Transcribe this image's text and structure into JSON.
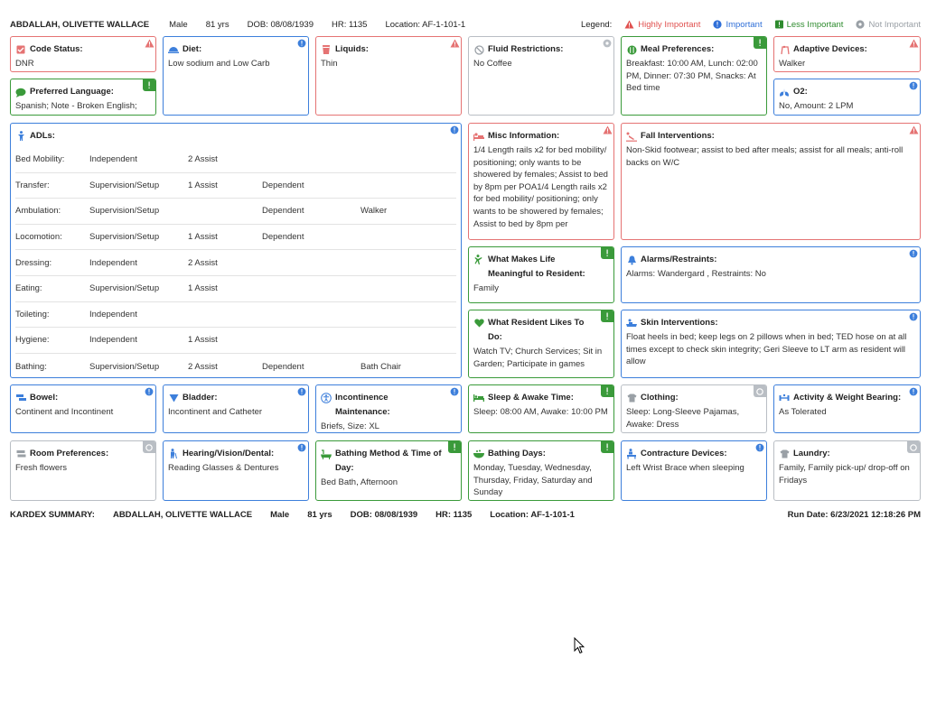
{
  "header": {
    "name": "ABDALLAH, OLIVETTE WALLACE",
    "sex": "Male",
    "age": "81 yrs",
    "dob": "DOB: 08/08/1939",
    "hr": "HR:  1135",
    "location": "Location:  AF-1-101-1"
  },
  "legend": {
    "title": "Legend:",
    "highly": "Highly Important",
    "important": "Important",
    "less": "Less Important",
    "not": "Not Important"
  },
  "colors": {
    "red": "#e57373",
    "blue": "#3d7fdb",
    "green": "#3a9a3a",
    "gray": "#b9bec4"
  },
  "cards": {
    "code_status": {
      "title": "Code Status:",
      "value": "DNR",
      "icon": "check-square-icon",
      "level": "highly-important"
    },
    "diet": {
      "title": "Diet:",
      "value": "Low sodium and Low Carb",
      "icon": "cloche-icon",
      "level": "important"
    },
    "liquids": {
      "title": "Liquids:",
      "value": "Thin",
      "icon": "cup-icon",
      "level": "highly-important"
    },
    "fluid_restrictions": {
      "title": "Fluid Restrictions:",
      "value": "No Coffee",
      "icon": "no-symbol-icon",
      "level": "not-important"
    },
    "meal_preferences": {
      "title": "Meal Preferences:",
      "value": "Breakfast: 10:00 AM, Lunch: 02:00 PM, Dinner: 07:30 PM, Snacks: At Bed time",
      "icon": "utensils-icon",
      "level": "less-important"
    },
    "adaptive_devices": {
      "title": "Adaptive Devices:",
      "value": "Walker",
      "icon": "walker-icon",
      "level": "highly-important"
    },
    "preferred_language": {
      "title": "Preferred Language:",
      "value": "Spanish; Note - Broken English;",
      "icon": "speech-bubble-icon",
      "level": "less-important"
    },
    "o2": {
      "title": "O2:",
      "value": "No, Amount: 2 LPM",
      "icon": "lungs-icon",
      "level": "important"
    },
    "adls": {
      "title": "ADLs:",
      "icon": "person-icon",
      "level": "important"
    },
    "misc": {
      "title": "Misc Information:",
      "value": "1/4 Length rails x2 for bed mobility/ positioning; only wants to be showered by females; Assist to bed by 8pm per POA1/4 Length rails x2 for bed mobility/ positioning; only wants to be showered by females; Assist to bed by 8pm per",
      "icon": "bed-person-icon",
      "level": "highly-important"
    },
    "fall": {
      "title": "Fall Interventions:",
      "value": "Non-Skid footwear; assist to bed after meals; assist for all meals; anti-roll backs on W/C",
      "icon": "falling-person-icon",
      "level": "highly-important"
    },
    "meaningful": {
      "title": "What Makes Life Meaningful to Resident:",
      "value": "Family",
      "icon": "dancing-person-icon",
      "level": "less-important"
    },
    "alarms": {
      "title": "Alarms/Restraints:",
      "value": "Alarms: Wandergard , Restraints: No",
      "icon": "bell-icon",
      "level": "important"
    },
    "likes": {
      "title": "What Resident Likes To Do:",
      "value": "Watch TV; Church Services; Sit in Garden; Participate in games",
      "icon": "heart-icon",
      "level": "less-important"
    },
    "skin": {
      "title": "Skin Interventions:",
      "value": "Float heels in bed; keep legs on 2 pillows when in bed; TED hose on at all times except to check skin integrity; Geri Sleeve to LT arm as resident will allow",
      "icon": "bath-person-icon",
      "level": "important"
    },
    "bowel": {
      "title": "Bowel:",
      "value": "Continent and Incontinent",
      "icon": "pipe-icon",
      "level": "important"
    },
    "bladder": {
      "title": "Bladder:",
      "value": "Incontinent and Catheter",
      "icon": "drop-icon",
      "level": "important"
    },
    "incontinence": {
      "title": "Incontinence Maintenance:",
      "value": "Briefs, Size: XL",
      "icon": "accessibility-icon",
      "level": "important"
    },
    "sleep": {
      "title": "Sleep & Awake Time:",
      "value": "Sleep: 08:00 AM, Awake: 10:00 PM",
      "icon": "bed-icon",
      "level": "less-important"
    },
    "clothing": {
      "title": "Clothing:",
      "value": "Sleep: Long-Sleeve Pajamas, Awake: Dress",
      "icon": "shirt-icon",
      "level": "not-important"
    },
    "activity": {
      "title": "Activity & Weight Bearing:",
      "value": "As Tolerated",
      "icon": "dumbbell-icon",
      "level": "important"
    },
    "room": {
      "title": "Room Preferences:",
      "value": "Fresh flowers",
      "icon": "signpost-icon",
      "level": "not-important"
    },
    "hearing": {
      "title": "Hearing/Vision/Dental:",
      "value": "Reading Glasses & Dentures",
      "icon": "cane-person-icon",
      "level": "important"
    },
    "bathing_method": {
      "title": "Bathing Method & Time of Day:",
      "value": "Bed Bath, Afternoon",
      "icon": "bathtub-icon",
      "level": "less-important"
    },
    "bathing_days": {
      "title": "Bathing Days:",
      "value": "Monday, Tuesday, Wednesday, Thursday, Friday, Saturday and Sunday",
      "icon": "basin-icon",
      "level": "less-important"
    },
    "contracture": {
      "title": "Contracture Devices:",
      "value": "Left Wrist Brace when sleeping",
      "icon": "wheelchair-person-icon",
      "level": "important"
    },
    "laundry": {
      "title": "Laundry:",
      "value": "Family, Family pick-up/ drop-off on Fridays",
      "icon": "tshirt-icon",
      "level": "not-important"
    }
  },
  "adl_rows": [
    {
      "label": "Bed Mobility:",
      "a": "Independent",
      "b": "2 Assist",
      "c": "",
      "d": ""
    },
    {
      "label": "Transfer:",
      "a": "Supervision/Setup",
      "b": "1 Assist",
      "c": "Dependent",
      "d": ""
    },
    {
      "label": "Ambulation:",
      "a": "Supervision/Setup",
      "b": "",
      "c": "Dependent",
      "d": "Walker"
    },
    {
      "label": "Locomotion:",
      "a": "Supervision/Setup",
      "b": "1 Assist",
      "c": "Dependent",
      "d": ""
    },
    {
      "label": "Dressing:",
      "a": "Independent",
      "b": "2 Assist",
      "c": "",
      "d": ""
    },
    {
      "label": "Eating:",
      "a": "Supervision/Setup",
      "b": "1 Assist",
      "c": "",
      "d": ""
    },
    {
      "label": "Toileting:",
      "a": "Independent",
      "b": "",
      "c": "",
      "d": ""
    },
    {
      "label": "Hygiene:",
      "a": "Independent",
      "b": "1 Assist",
      "c": "",
      "d": ""
    },
    {
      "label": "Bathing:",
      "a": "Supervision/Setup",
      "b": "2 Assist",
      "c": "Dependent",
      "d": "Bath Chair"
    }
  ],
  "footer": {
    "summary": "KARDEX SUMMARY:",
    "name": "ABDALLAH, OLIVETTE WALLACE",
    "sex": "Male",
    "age": "81 yrs",
    "dob": "DOB: 08/08/1939",
    "hr": "HR:  1135",
    "location": "Location:  AF-1-101-1",
    "run_date": "Run Date: 6/23/2021 12:18:26 PM"
  }
}
